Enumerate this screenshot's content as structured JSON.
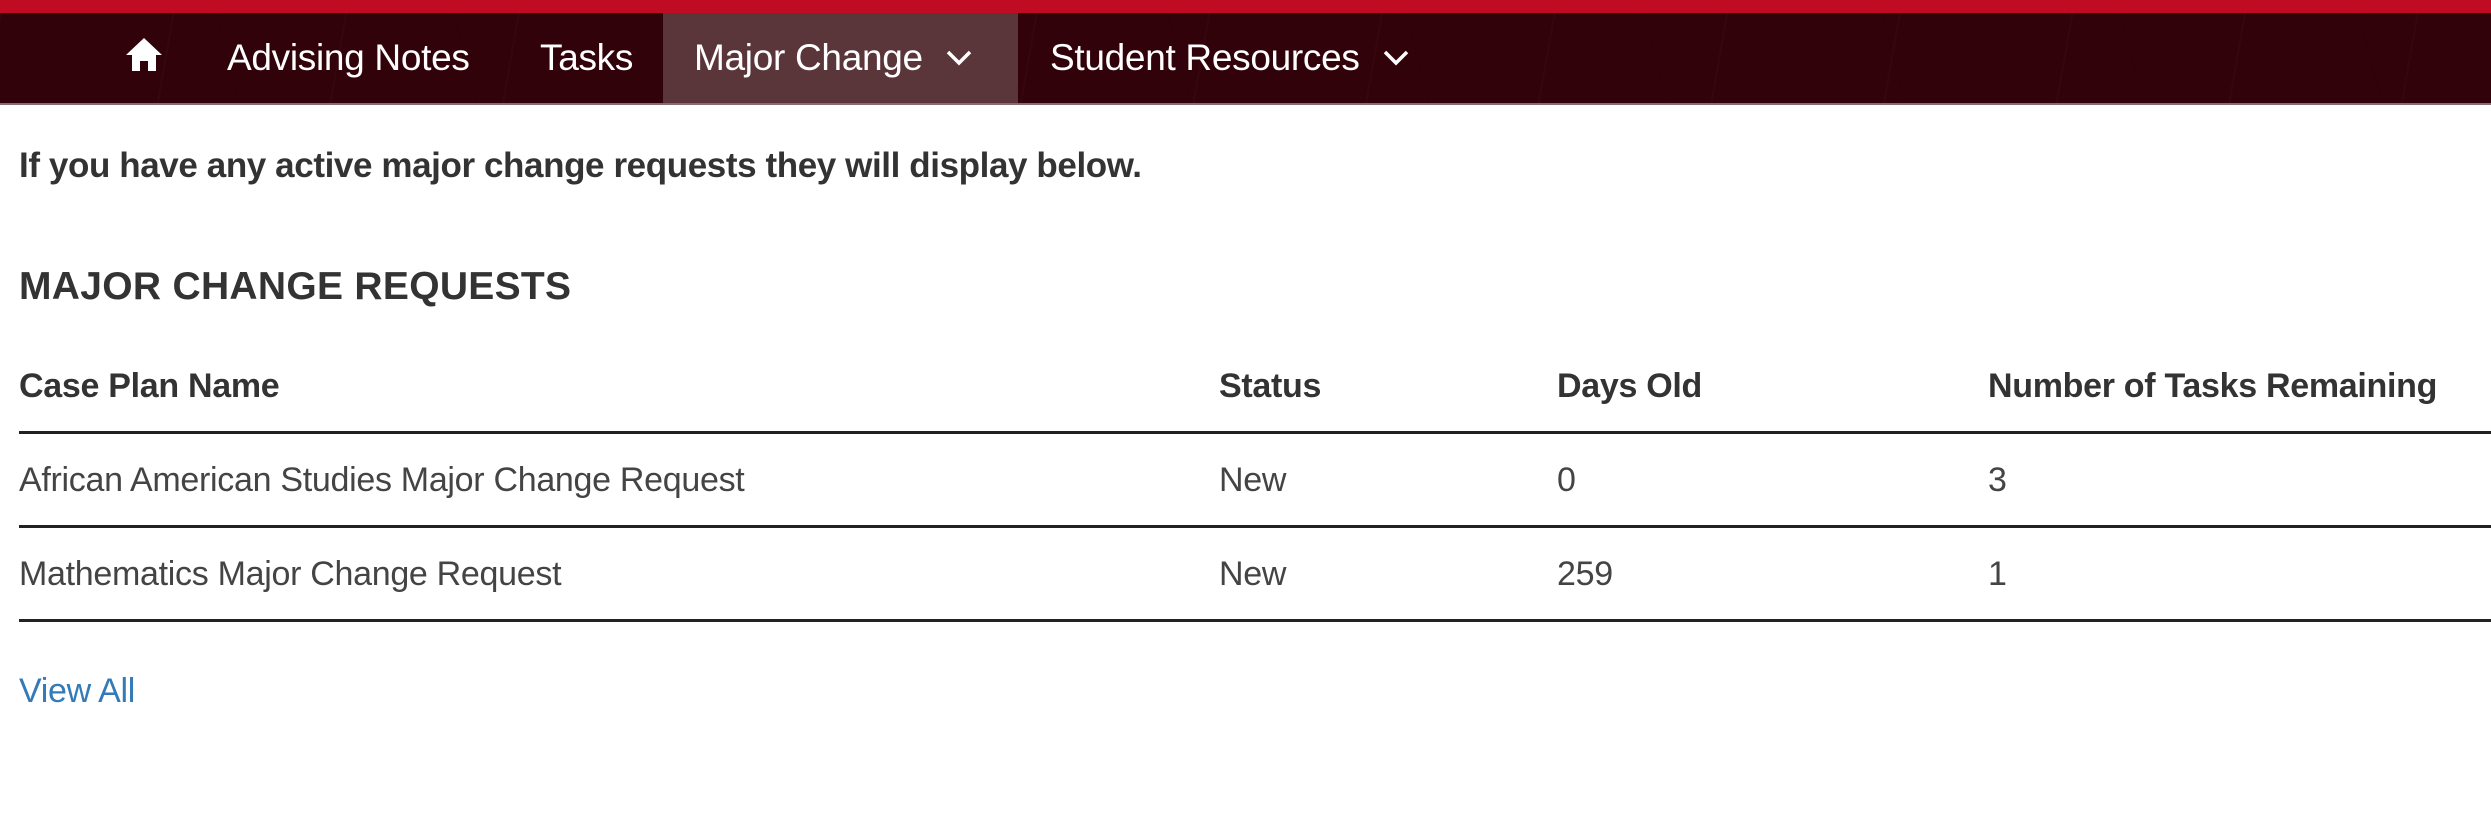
{
  "nav": {
    "home_icon": "home-icon",
    "items": [
      {
        "label": "Advising Notes",
        "has_dropdown": false,
        "active": false
      },
      {
        "label": "Tasks",
        "has_dropdown": false,
        "active": false
      },
      {
        "label": "Major Change",
        "has_dropdown": true,
        "active": true
      },
      {
        "label": "Student Resources",
        "has_dropdown": true,
        "active": false
      }
    ],
    "colors": {
      "top_band": "#c00c22",
      "bar": "#32020b",
      "active": "#5a363b"
    }
  },
  "main": {
    "intro": "If you have any active major change requests they will display below.",
    "heading": "MAJOR CHANGE REQUESTS",
    "table": {
      "columns": [
        "Case Plan Name",
        "Status",
        "Days Old",
        "Number of Tasks Remaining"
      ],
      "rows": [
        {
          "name": "African American Studies Major Change Request",
          "status": "New",
          "days_old": "0",
          "tasks_remaining": "3"
        },
        {
          "name": "Mathematics Major Change Request",
          "status": "New",
          "days_old": "259",
          "tasks_remaining": "1"
        }
      ]
    },
    "view_all": "View All",
    "link_color": "#337ab7"
  }
}
